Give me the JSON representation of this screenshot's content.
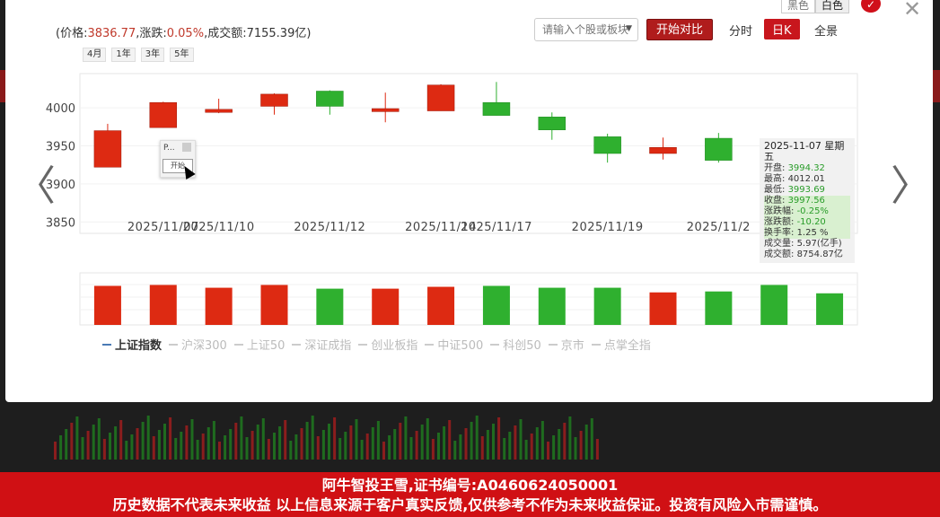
{
  "header": {
    "price_label": "价格:",
    "price": "3836.77",
    "change_label": ",涨跌:",
    "change": "0.05%",
    "turnover_label": ",成交额:",
    "turnover": "7155.39亿",
    "open_paren": "(",
    "close_paren": ")"
  },
  "ranges": [
    "4月",
    "1年",
    "3年",
    "5年"
  ],
  "theme": {
    "dark": "黑色",
    "light": "白色"
  },
  "search": {
    "placeholder": "请输入个股或板块"
  },
  "compare_button": "开始对比",
  "modes": {
    "intraday": "分时",
    "daily": "日K",
    "overview": "全景"
  },
  "tooltip": {
    "date": "2025-11-07 星期五",
    "rows": [
      {
        "label": "开盘:",
        "value": "3994.32"
      },
      {
        "label": "最高:",
        "value": "4012.01"
      },
      {
        "label": "最低:",
        "value": "3993.69"
      },
      {
        "label": "收盘:",
        "value": "3997.56"
      },
      {
        "label": "涨跌幅:",
        "value": "-0.25%"
      },
      {
        "label": "涨跌额:",
        "value": "-10.20"
      },
      {
        "label": "换手率:",
        "value": "1.25 %"
      },
      {
        "label": "成交量:",
        "value": "5.97(亿手)"
      },
      {
        "label": "成交额:",
        "value": "8754.87亿"
      }
    ]
  },
  "mini_popup": {
    "title": "P...",
    "button": "开始"
  },
  "legend": [
    {
      "label": "上证指数",
      "active": true
    },
    {
      "label": "沪深300",
      "active": false
    },
    {
      "label": "上证50",
      "active": false
    },
    {
      "label": "深证成指",
      "active": false
    },
    {
      "label": "创业板指",
      "active": false
    },
    {
      "label": "中证500",
      "active": false
    },
    {
      "label": "科创50",
      "active": false
    },
    {
      "label": "京市",
      "active": false
    },
    {
      "label": "点掌全指",
      "active": false
    }
  ],
  "banner": {
    "line1": "阿牛智投王雪,证书编号:A0460624050001",
    "line2": "历史数据不代表未来收益 以上信息来源于客户真实反馈,仅供参考不作为未来收益保证。投资有风险入市需谨慎。"
  },
  "colors": {
    "up": "#dd2a12",
    "down": "#2fb02f",
    "accent": "#c8161d"
  },
  "chart_data": {
    "type": "candlestick",
    "ylim": [
      3835,
      4045
    ],
    "yticks": [
      3850,
      3900,
      3950,
      4000
    ],
    "x_labels": [
      {
        "index": 1,
        "label": "2025/11/07"
      },
      {
        "index": 2,
        "label": "2025/11/10"
      },
      {
        "index": 4,
        "label": "2025/11/12"
      },
      {
        "index": 6,
        "label": "2025/11/14"
      },
      {
        "index": 7,
        "label": "2025/11/17"
      },
      {
        "index": 9,
        "label": "2025/11/19"
      },
      {
        "index": 11,
        "label": "2025/11/2"
      }
    ],
    "candles": [
      {
        "open": 3922,
        "close": 3970,
        "high": 3979,
        "low": 3922,
        "dir": "up"
      },
      {
        "open": 3974,
        "close": 4007,
        "high": 4008,
        "low": 3974,
        "dir": "up"
      },
      {
        "open": 3994,
        "close": 3998,
        "high": 4012,
        "low": 3993,
        "dir": "up"
      },
      {
        "open": 4002,
        "close": 4018,
        "high": 4019,
        "low": 3991,
        "dir": "up"
      },
      {
        "open": 4022,
        "close": 4002,
        "high": 4023,
        "low": 3991,
        "dir": "down"
      },
      {
        "open": 3995,
        "close": 3999,
        "high": 4020,
        "low": 3981,
        "dir": "up"
      },
      {
        "open": 3996,
        "close": 4030,
        "high": 4031,
        "low": 3996,
        "dir": "up"
      },
      {
        "open": 4007,
        "close": 3990,
        "high": 4034,
        "low": 3990,
        "dir": "down"
      },
      {
        "open": 3988,
        "close": 3971,
        "high": 3994,
        "low": 3958,
        "dir": "down"
      },
      {
        "open": 3962,
        "close": 3940,
        "high": 3966,
        "low": 3928,
        "dir": "down"
      },
      {
        "open": 3940,
        "close": 3948,
        "high": 3961,
        "low": 3932,
        "dir": "up"
      },
      {
        "open": 3960,
        "close": 3931,
        "high": 3967,
        "low": 3928,
        "dir": "down"
      },
      {
        "dir": "down"
      },
      {
        "dir": "down"
      }
    ],
    "volume": {
      "ylim": [
        0,
        56
      ],
      "bars": [
        {
          "value": 42,
          "dir": "up"
        },
        {
          "value": 43,
          "dir": "up"
        },
        {
          "value": 40,
          "dir": "up"
        },
        {
          "value": 43,
          "dir": "up"
        },
        {
          "value": 39,
          "dir": "down"
        },
        {
          "value": 39,
          "dir": "up"
        },
        {
          "value": 41,
          "dir": "up"
        },
        {
          "value": 42,
          "dir": "down"
        },
        {
          "value": 40,
          "dir": "down"
        },
        {
          "value": 40,
          "dir": "down"
        },
        {
          "value": 35,
          "dir": "up"
        },
        {
          "value": 36,
          "dir": "down"
        },
        {
          "value": 43,
          "dir": "down"
        },
        {
          "value": 34,
          "dir": "down"
        }
      ]
    }
  }
}
